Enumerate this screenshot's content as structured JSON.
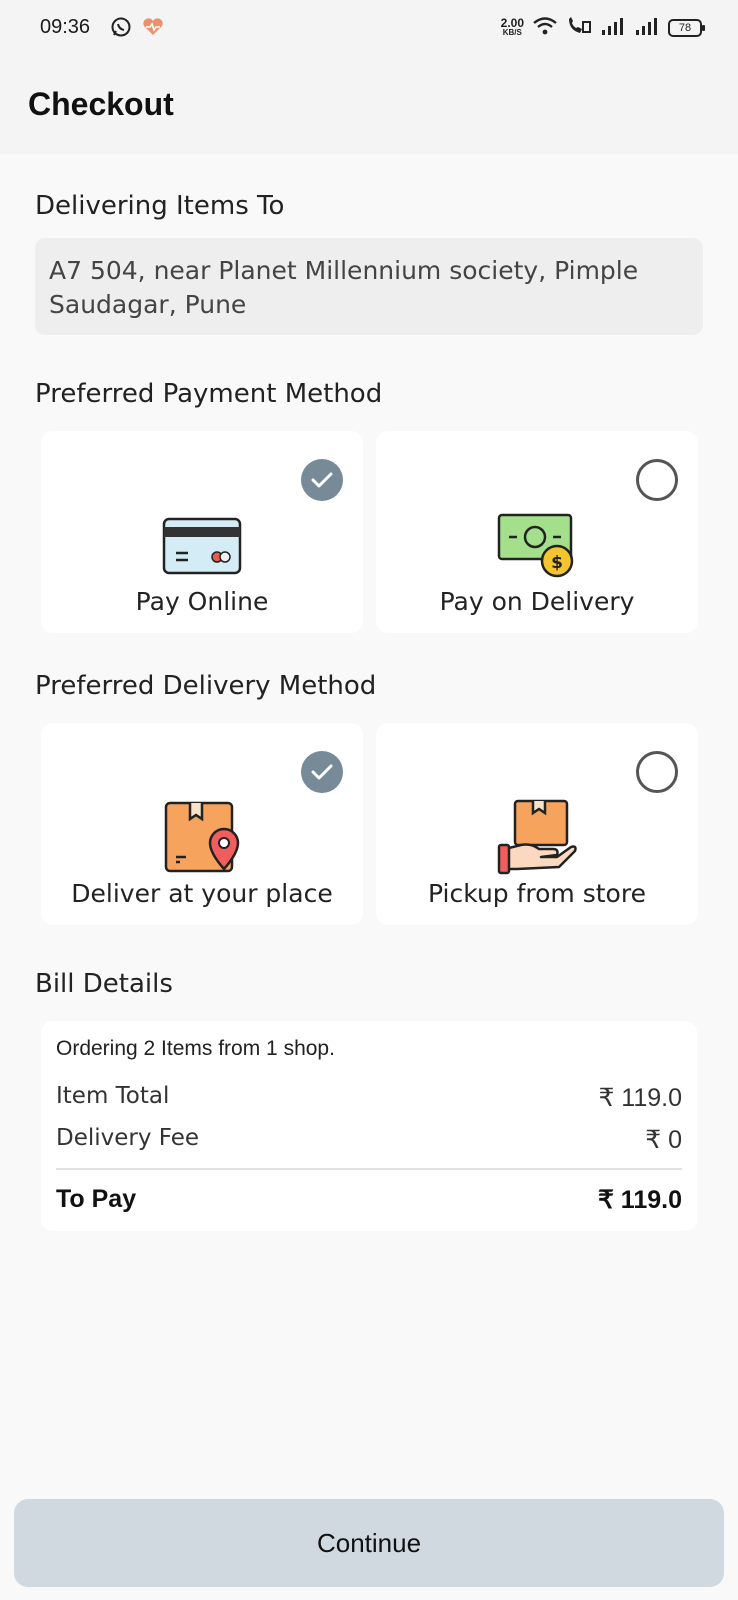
{
  "status_bar": {
    "time": "09:36",
    "net_speed_value": "2.00",
    "net_speed_unit": "KB/S",
    "battery": "78"
  },
  "header": {
    "title": "Checkout"
  },
  "delivery_address": {
    "label": "Delivering Items To",
    "address": "A7 504, near Planet Millennium society, Pimple Saudagar, Pune"
  },
  "payment": {
    "label": "Preferred Payment Method",
    "options": [
      {
        "label": "Pay Online",
        "selected": true,
        "icon": "credit-card-icon"
      },
      {
        "label": "Pay on Delivery",
        "selected": false,
        "icon": "cash-icon"
      }
    ]
  },
  "delivery": {
    "label": "Preferred Delivery Method",
    "options": [
      {
        "label": "Deliver at your place",
        "selected": true,
        "icon": "package-location-icon"
      },
      {
        "label": "Pickup from store",
        "selected": false,
        "icon": "hand-package-icon"
      }
    ]
  },
  "bill": {
    "label": "Bill Details",
    "intro": "Ordering 2 Items from 1 shop.",
    "item_total_label": "Item Total",
    "item_total_value": "₹ 119.0",
    "delivery_fee_label": "Delivery Fee",
    "delivery_fee_value": "₹ 0",
    "to_pay_label": "To Pay",
    "to_pay_value": "₹ 119.0"
  },
  "actions": {
    "continue_label": "Continue"
  },
  "colors": {
    "check_selected": "#778a97",
    "continue_bg": "#d0d9e0",
    "card_bg": "#ffffff"
  }
}
